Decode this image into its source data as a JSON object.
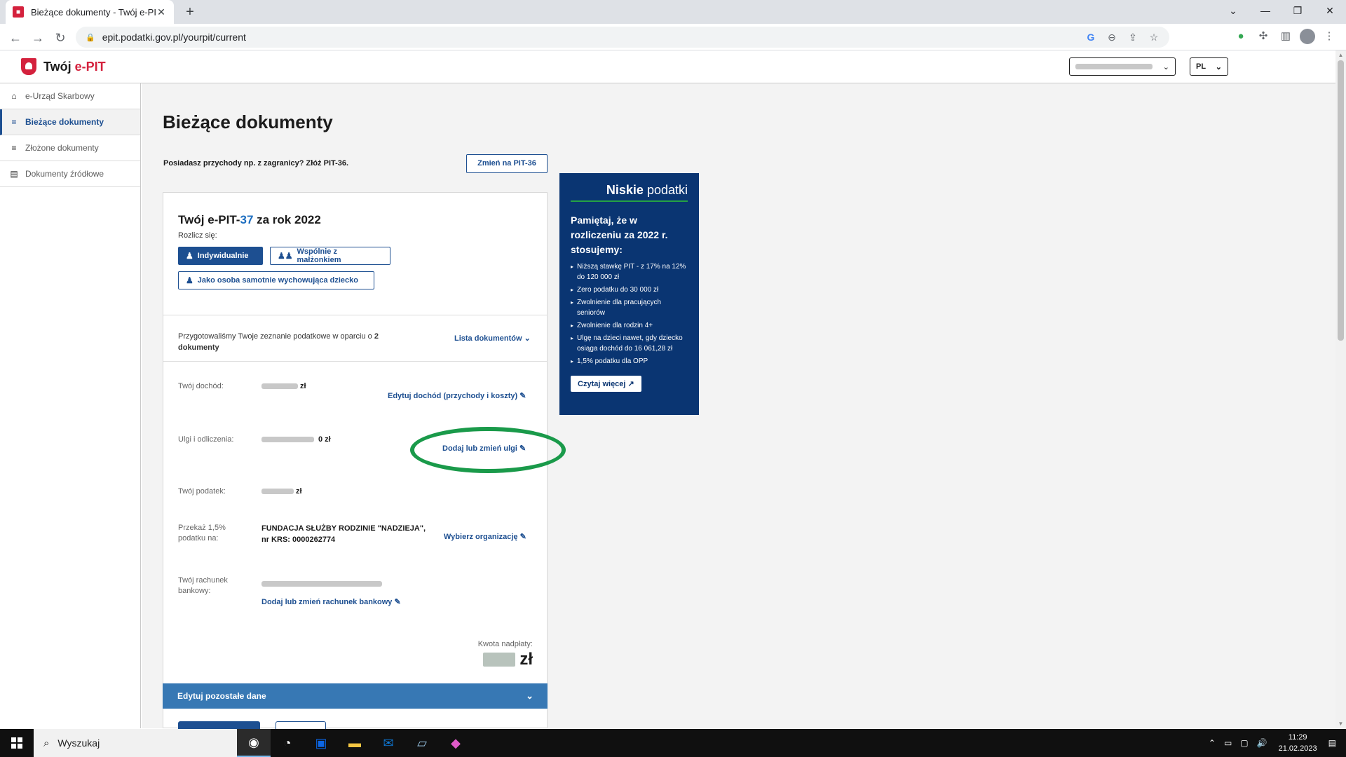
{
  "browser": {
    "tab_title": "Bieżące dokumenty - Twój e-PIT",
    "tab_close": "✕",
    "new_tab": "+",
    "url": "epit.podatki.gov.pl/yourpit/current"
  },
  "site": {
    "brand_prefix": "Twój ",
    "brand_accent": "e-PIT",
    "lang": "PL"
  },
  "sidebar": {
    "items": [
      {
        "label": "e-Urząd Skarbowy",
        "icon": "home-icon"
      },
      {
        "label": "Bieżące dokumenty",
        "icon": "current-docs-icon"
      },
      {
        "label": "Złożone dokumenty",
        "icon": "submitted-docs-icon"
      },
      {
        "label": "Dokumenty źródłowe",
        "icon": "source-docs-icon"
      }
    ]
  },
  "main": {
    "title": "Bieżące dokumenty",
    "pit36_prompt": "Posiadasz przychody np. z zagranicy? Złóż PIT-36.",
    "pit36_button": "Zmień na PIT-36"
  },
  "card": {
    "title_prefix": "Twój ",
    "title_form_a": "e-PIT-",
    "title_form_b": "37",
    "title_suffix": " za rok 2022",
    "rozlicz_label": "Rozlicz się:",
    "options": [
      "Indywidualnie",
      "Wspólnie z małżonkiem",
      "Jako osoba samotnie wychowująca dziecko"
    ],
    "prepared_text": "Przygotowaliśmy Twoje zeznanie podatkowe w oparciu o ",
    "prepared_count": "2 dokumenty",
    "doc_list_link": "Lista dokumentów",
    "income_label": "Twój dochód:",
    "income_unit": "zł",
    "income_edit_link": "Edytuj dochód (przychody i koszty)",
    "relief_label": "Ulgi i odliczenia:",
    "relief_value": "0 zł",
    "relief_link": "Dodaj lub zmień ulgi",
    "tax_label": "Twój podatek:",
    "tax_unit": "zł",
    "opp_label": "Przekaż 1,5% podatku na:",
    "opp_value": "FUNDACJA SŁUŻBY RODZINIE \"NADZIEJA\", nr KRS: 0000262774",
    "opp_link": "Wybierz organizację",
    "bank_label": "Twój rachunek bankowy:",
    "bank_link": "Dodaj lub zmień rachunek bankowy",
    "refund_label": "Kwota nadpłaty:",
    "refund_unit": "zł",
    "footer_label": "Edytuj pozostałe dane"
  },
  "promo": {
    "brand_bold": "Niskie",
    "brand_light": " podatki",
    "heading": "Pamiętaj, że w rozliczeniu za 2022 r. stosujemy:",
    "items": [
      "Niższą stawkę PIT - z 17% na 12% do 120 000 zł",
      "Zero podatku do 30 000 zł",
      "Zwolnienie dla pracujących seniorów",
      "Zwolnienie dla rodzin 4+",
      "Ulgę na dzieci nawet, gdy dziecko osiąga dochód do 16 061,28 zł",
      "1,5% podatku dla OPP"
    ],
    "button": "Czytaj więcej"
  },
  "taskbar": {
    "search_placeholder": "Wyszukaj",
    "time": "11:29",
    "date": "21.02.2023"
  },
  "colors": {
    "primary": "#1d4f91",
    "accent_red": "#d4213d",
    "promo_bg": "#0a3572",
    "footer_bar": "#3778b4",
    "annotation": "#1a9a4a"
  }
}
